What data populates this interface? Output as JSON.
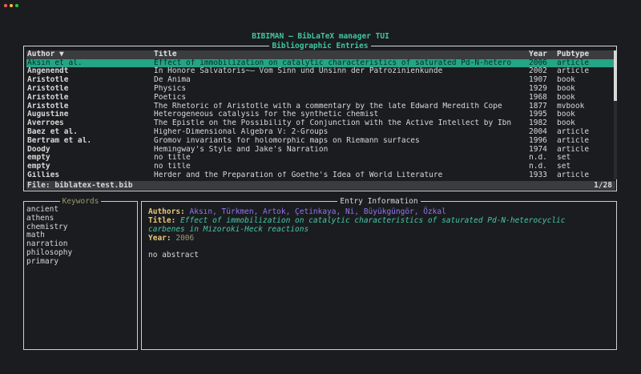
{
  "window_controls": [
    {
      "name": "close",
      "color": "#ff5f57"
    },
    {
      "name": "minimize",
      "color": "#febc2e"
    },
    {
      "name": "maximize",
      "color": "#28c840"
    }
  ],
  "app_title": "BIBIMAN – BibLaTeX manager TUI",
  "entries_panel": {
    "title": "Bibliographic Entries",
    "columns": {
      "author": "Author ▼",
      "title": "Title",
      "year": "Year",
      "pubtype": "Pubtype"
    },
    "rows": [
      {
        "author": "Aksın et al.",
        "title": "Effect of immobilization on catalytic characteristics of saturated Pd-N-hetero",
        "year": "2006",
        "pubtype": "article"
      },
      {
        "author": "Angenendt",
        "title": "In Honore Salvatoris~— Vom Sinn und Unsinn der Patrozinienkunde",
        "year": "2002",
        "pubtype": "article"
      },
      {
        "author": "Aristotle",
        "title": "De Anima",
        "year": "1907",
        "pubtype": "book"
      },
      {
        "author": "Aristotle",
        "title": "Physics",
        "year": "1929",
        "pubtype": "book"
      },
      {
        "author": "Aristotle",
        "title": "Poetics",
        "year": "1968",
        "pubtype": "book"
      },
      {
        "author": "Aristotle",
        "title": "The Rhetoric of Aristotle with a commentary by the late Edward Meredith Cope",
        "year": "1877",
        "pubtype": "mvbook"
      },
      {
        "author": "Augustine",
        "title": "Heterogeneous catalysis for the synthetic chemist",
        "year": "1995",
        "pubtype": "book"
      },
      {
        "author": "Averroes",
        "title": "The Epistle on the Possibility of Conjunction with the Active Intellect by Ibn",
        "year": "1982",
        "pubtype": "book"
      },
      {
        "author": "Baez et al.",
        "title": "Higher-Dimensional Algebra V: 2-Groups",
        "year": "2004",
        "pubtype": "article"
      },
      {
        "author": "Bertram et al.",
        "title": "Gromov invariants for holomorphic maps on Riemann surfaces",
        "year": "1996",
        "pubtype": "article"
      },
      {
        "author": "Doody",
        "title": "Hemingway's Style and Jake's Narration",
        "year": "1974",
        "pubtype": "article"
      },
      {
        "author": "empty",
        "title": "no title",
        "year": "n.d.",
        "pubtype": "set"
      },
      {
        "author": "empty",
        "title": "no title",
        "year": "n.d.",
        "pubtype": "set"
      },
      {
        "author": "Gillies",
        "title": "Herder and the Preparation of Goethe's Idea of World Literature",
        "year": "1933",
        "pubtype": "article"
      }
    ],
    "selected_index": 0,
    "footer": {
      "file": "File: biblatex-test.bib",
      "position": "1/28"
    }
  },
  "keywords_panel": {
    "title": "Keywords",
    "items": [
      "ancient",
      "athens",
      "chemistry",
      "math",
      "narration",
      "philosophy",
      "primary"
    ]
  },
  "info_panel": {
    "title": "Entry Information",
    "authors_label": "Authors:",
    "authors_value": "Aksın, Türkmen, Artok, Çetinkaya, Ni, Büyükgüngör, Özkal",
    "title_label": "Title:",
    "title_line1": "Effect of immobilization on catalytic characteristics of saturated Pd-N-heterocyclic",
    "title_line2": "carbenes in Mizoroki-Heck reactions",
    "year_label": "Year:",
    "year_value": "2006",
    "abstract": "no abstract"
  },
  "colors": {
    "background": "#1b1c1f",
    "accent": "#41c6a0",
    "selection": "#24a586",
    "authors": "#8e78f2",
    "label": "#e6c87a"
  }
}
